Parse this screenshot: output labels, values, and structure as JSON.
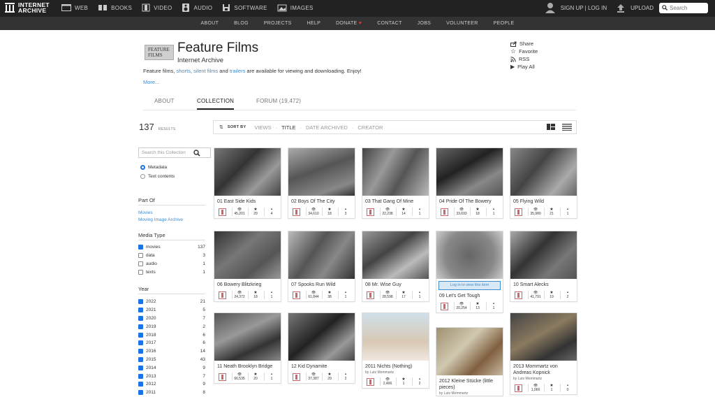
{
  "topbar": {
    "logo_line1": "INTERNET",
    "logo_line2": "ARCHIVE",
    "nav": [
      {
        "label": "WEB"
      },
      {
        "label": "BOOKS"
      },
      {
        "label": "VIDEO"
      },
      {
        "label": "AUDIO"
      },
      {
        "label": "SOFTWARE"
      },
      {
        "label": "IMAGES"
      }
    ],
    "auth": "SIGN UP | LOG IN",
    "upload": "UPLOAD",
    "search_placeholder": "Search"
  },
  "subnav": [
    "ABOUT",
    "BLOG",
    "PROJECTS",
    "HELP",
    "DONATE",
    "CONTACT",
    "JOBS",
    "VOLUNTEER",
    "PEOPLE"
  ],
  "collection": {
    "logo_text_line1": "FEATURE",
    "logo_text_line2": "FILMS",
    "title": "Feature Films",
    "subtitle": "Internet Archive",
    "desc_pre": "Feature films, ",
    "desc_link1": "shorts",
    "desc_sep1": ", ",
    "desc_link2": "silent films",
    "desc_mid": " and ",
    "desc_link3": "trailers",
    "desc_post": " are available for viewing and downloading. Enjoy!",
    "more": "More..."
  },
  "actions": [
    "Share",
    "Favorite",
    "RSS",
    "Play All"
  ],
  "tabs": {
    "about": "ABOUT",
    "collection": "COLLECTION",
    "forum": "FORUM (19,472)"
  },
  "results": {
    "count": "137",
    "label": "RESULTS"
  },
  "sort": {
    "label": "SORT BY",
    "views": "VIEWS",
    "title": "TITLE",
    "date": "DATE ARCHIVED",
    "creator": "CREATOR"
  },
  "sidebar": {
    "search_placeholder": "Search this Collection",
    "metadata": "Metadata",
    "text_contents": "Text contents",
    "part_of_title": "Part Of",
    "part_of": [
      "Movies",
      "Moving Image Archive"
    ],
    "media_type_title": "Media Type",
    "media_types": [
      {
        "label": "movies",
        "count": "137",
        "checked": true
      },
      {
        "label": "data",
        "count": "3",
        "checked": false
      },
      {
        "label": "audio",
        "count": "1",
        "checked": false
      },
      {
        "label": "texts",
        "count": "1",
        "checked": false
      }
    ],
    "year_title": "Year",
    "years": [
      {
        "label": "2022",
        "count": "21"
      },
      {
        "label": "2021",
        "count": "5"
      },
      {
        "label": "2020",
        "count": "7"
      },
      {
        "label": "2019",
        "count": "2"
      },
      {
        "label": "2018",
        "count": "6"
      },
      {
        "label": "2017",
        "count": "6"
      },
      {
        "label": "2016",
        "count": "14"
      },
      {
        "label": "2015",
        "count": "43"
      },
      {
        "label": "2014",
        "count": "9"
      },
      {
        "label": "2013",
        "count": "7"
      },
      {
        "label": "2012",
        "count": "9"
      },
      {
        "label": "2011",
        "count": "8"
      }
    ]
  },
  "tiles": [
    {
      "title": "01 East Side Kids",
      "views": "45,201",
      "favs": "29",
      "reviews": "4"
    },
    {
      "title": "02 Boys Of The City",
      "views": "34,610",
      "favs": "18",
      "reviews": "3"
    },
    {
      "title": "03 That Gang Of Mine",
      "views": "22,238",
      "favs": "14",
      "reviews": "1"
    },
    {
      "title": "04 Pride Of The Bowery",
      "views": "33,693",
      "favs": "18",
      "reviews": "1"
    },
    {
      "title": "05 Flying Wild",
      "views": "35,980",
      "favs": "21",
      "reviews": "1"
    },
    {
      "title": "06 Bowery Blitzkrieg",
      "views": "24,372",
      "favs": "18",
      "reviews": "1"
    },
    {
      "title": "07 Spooks Run Wild",
      "views": "61,844",
      "favs": "38",
      "reviews": "1"
    },
    {
      "title": "08 Mr. Wise Guy",
      "views": "28,598",
      "favs": "17",
      "reviews": "1"
    },
    {
      "title": "09 Let's Get Tough",
      "views": "20,254",
      "favs": "13",
      "reviews": "1",
      "login": "Log in to view this item"
    },
    {
      "title": "10 Smart Alecks",
      "views": "41,791",
      "favs": "19",
      "reviews": "2"
    },
    {
      "title": "11 Neath Brooklyn Bridge",
      "views": "66,535",
      "favs": "20",
      "reviews": "1"
    },
    {
      "title": "12 Kid Dynamite",
      "views": "37,387",
      "favs": "29",
      "reviews": "2"
    },
    {
      "title": "2011 Nichts (Nothing)",
      "by": "by Lutz Mommartz",
      "views": "2,496",
      "favs": "1",
      "reviews": "2"
    },
    {
      "title": "2012 Kleine Stücke (little pieces)",
      "by": "by Lutz Mommartz",
      "views": "",
      "favs": "",
      "reviews": ""
    },
    {
      "title": "2013 Mommartz von Andreas Kopnick",
      "by": "by Lutz Mommartz",
      "views": "1,066",
      "favs": "1",
      "reviews": "0"
    }
  ],
  "colors": {
    "topbar": "#222222",
    "subnav": "#333333",
    "link": "#428bca",
    "checkbox": "#1a73e8"
  }
}
